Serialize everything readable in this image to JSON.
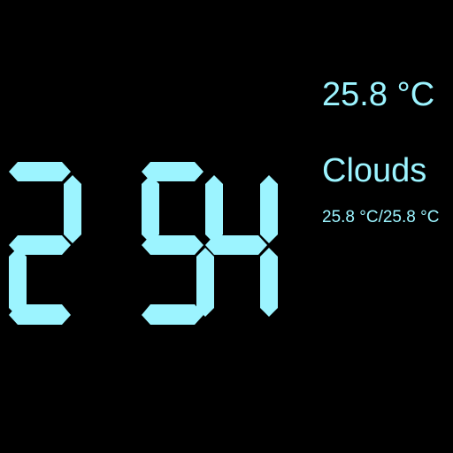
{
  "clock": {
    "time_text": "2 54",
    "digit_color": "#9cf4ff"
  },
  "weather": {
    "temperature": "25.8 °C",
    "condition": "Clouds",
    "temp_range": "25.8 °C/25.8 °C",
    "text_color": "#9cf4ff"
  }
}
